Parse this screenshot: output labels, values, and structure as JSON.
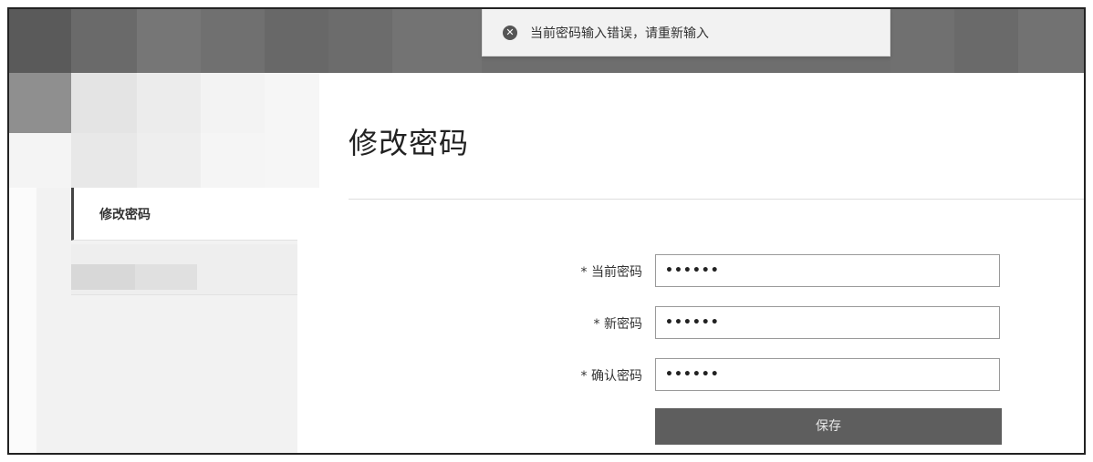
{
  "toast": {
    "message": "当前密码输入错误，请重新输入",
    "icon": "close-circle-icon"
  },
  "sidebar": {
    "items": [
      {
        "label": "修改密码",
        "active": true
      },
      {
        "label": "",
        "active": false
      }
    ]
  },
  "main": {
    "title": "修改密码",
    "form": {
      "fields": [
        {
          "label": "* 当前密码",
          "value": "••••••"
        },
        {
          "label": "* 新密码",
          "value": "••••••"
        },
        {
          "label": "* 确认密码",
          "value": "••••••"
        }
      ],
      "save_label": "保存"
    }
  },
  "colors": {
    "topbar": "#6e6e6e",
    "button": "#5e5e5e",
    "sidebar_bg": "#f2f2f2"
  }
}
